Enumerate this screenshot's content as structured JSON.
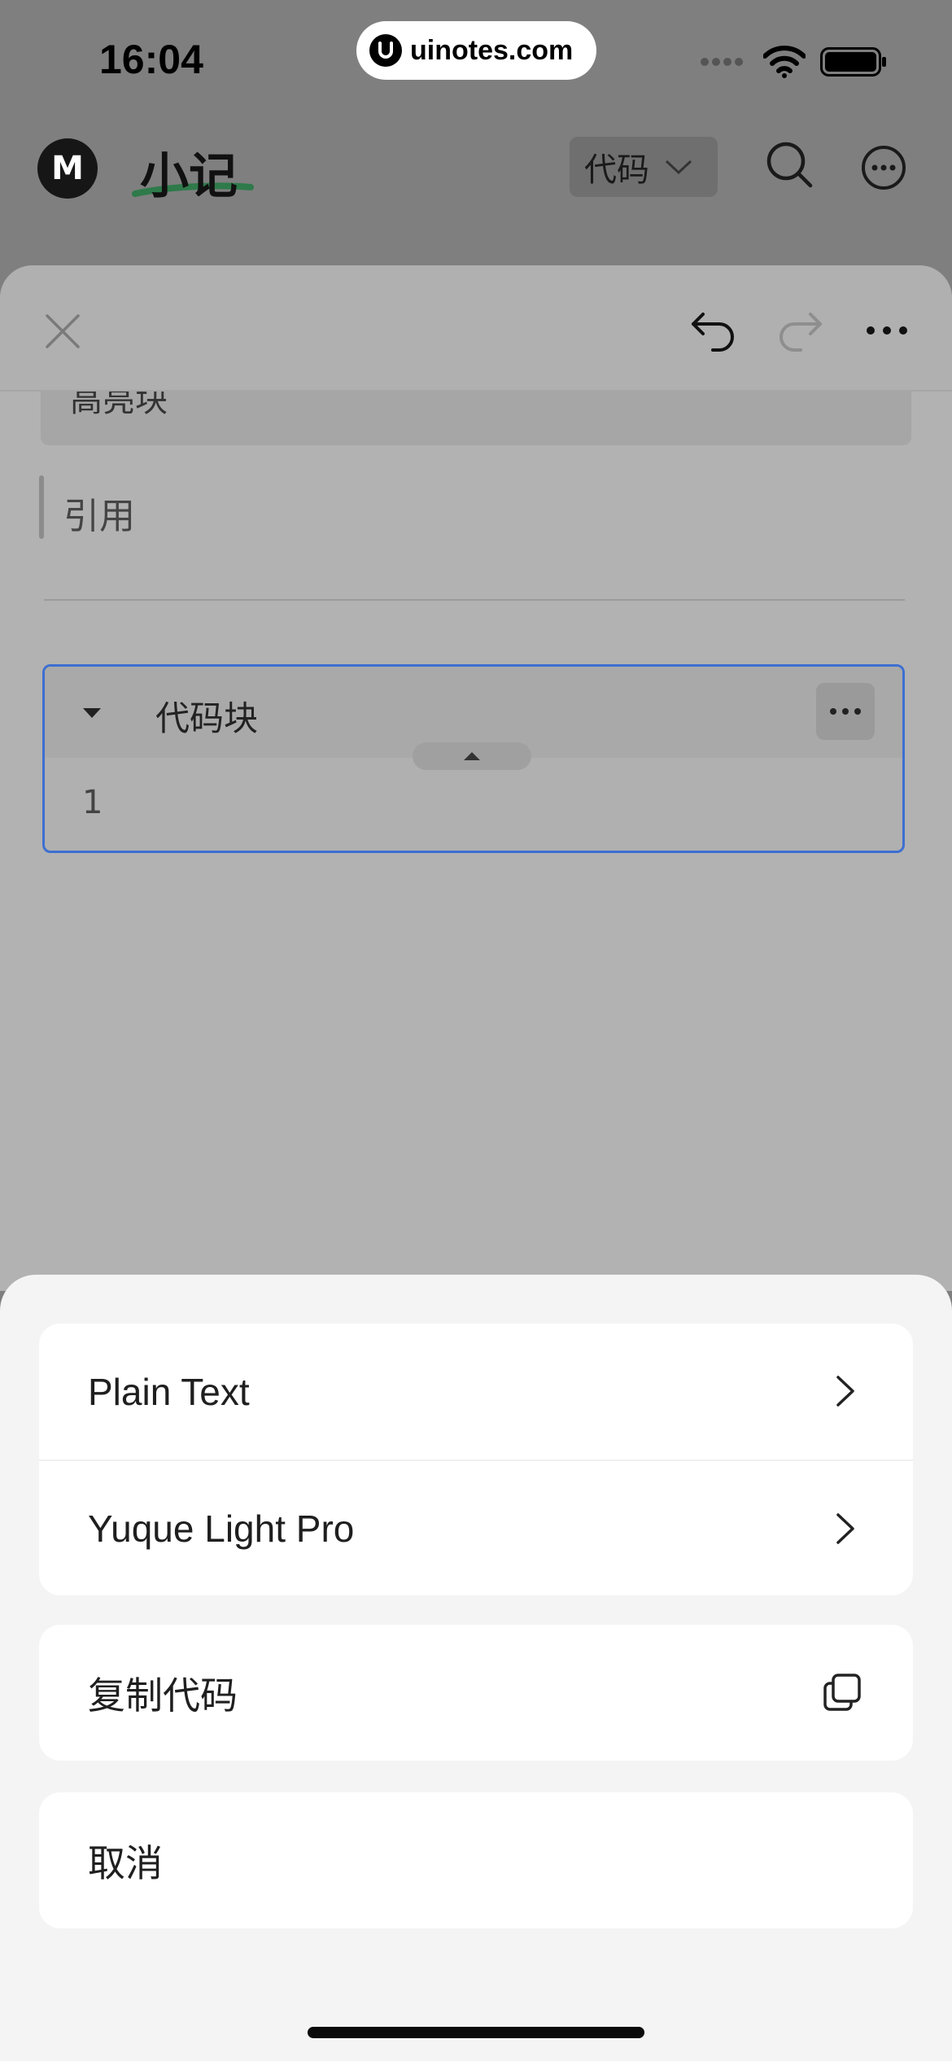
{
  "status_bar": {
    "time": "16:04",
    "url": "uinotes.com"
  },
  "header": {
    "logo_letter": "M",
    "title": "小记",
    "language_select": "代码",
    "accent_underline_color": "#2e9a57"
  },
  "editor": {
    "highlight_block_text": "高亮块",
    "quote_text": "引用",
    "code_block": {
      "language": "代码块",
      "line_number": "1",
      "border_color": "#3d6fd1"
    }
  },
  "action_sheet": {
    "theme_options": [
      "Plain Text",
      "Yuque Light Pro"
    ],
    "copy_code_label": "复制代码",
    "cancel_label": "取消"
  }
}
